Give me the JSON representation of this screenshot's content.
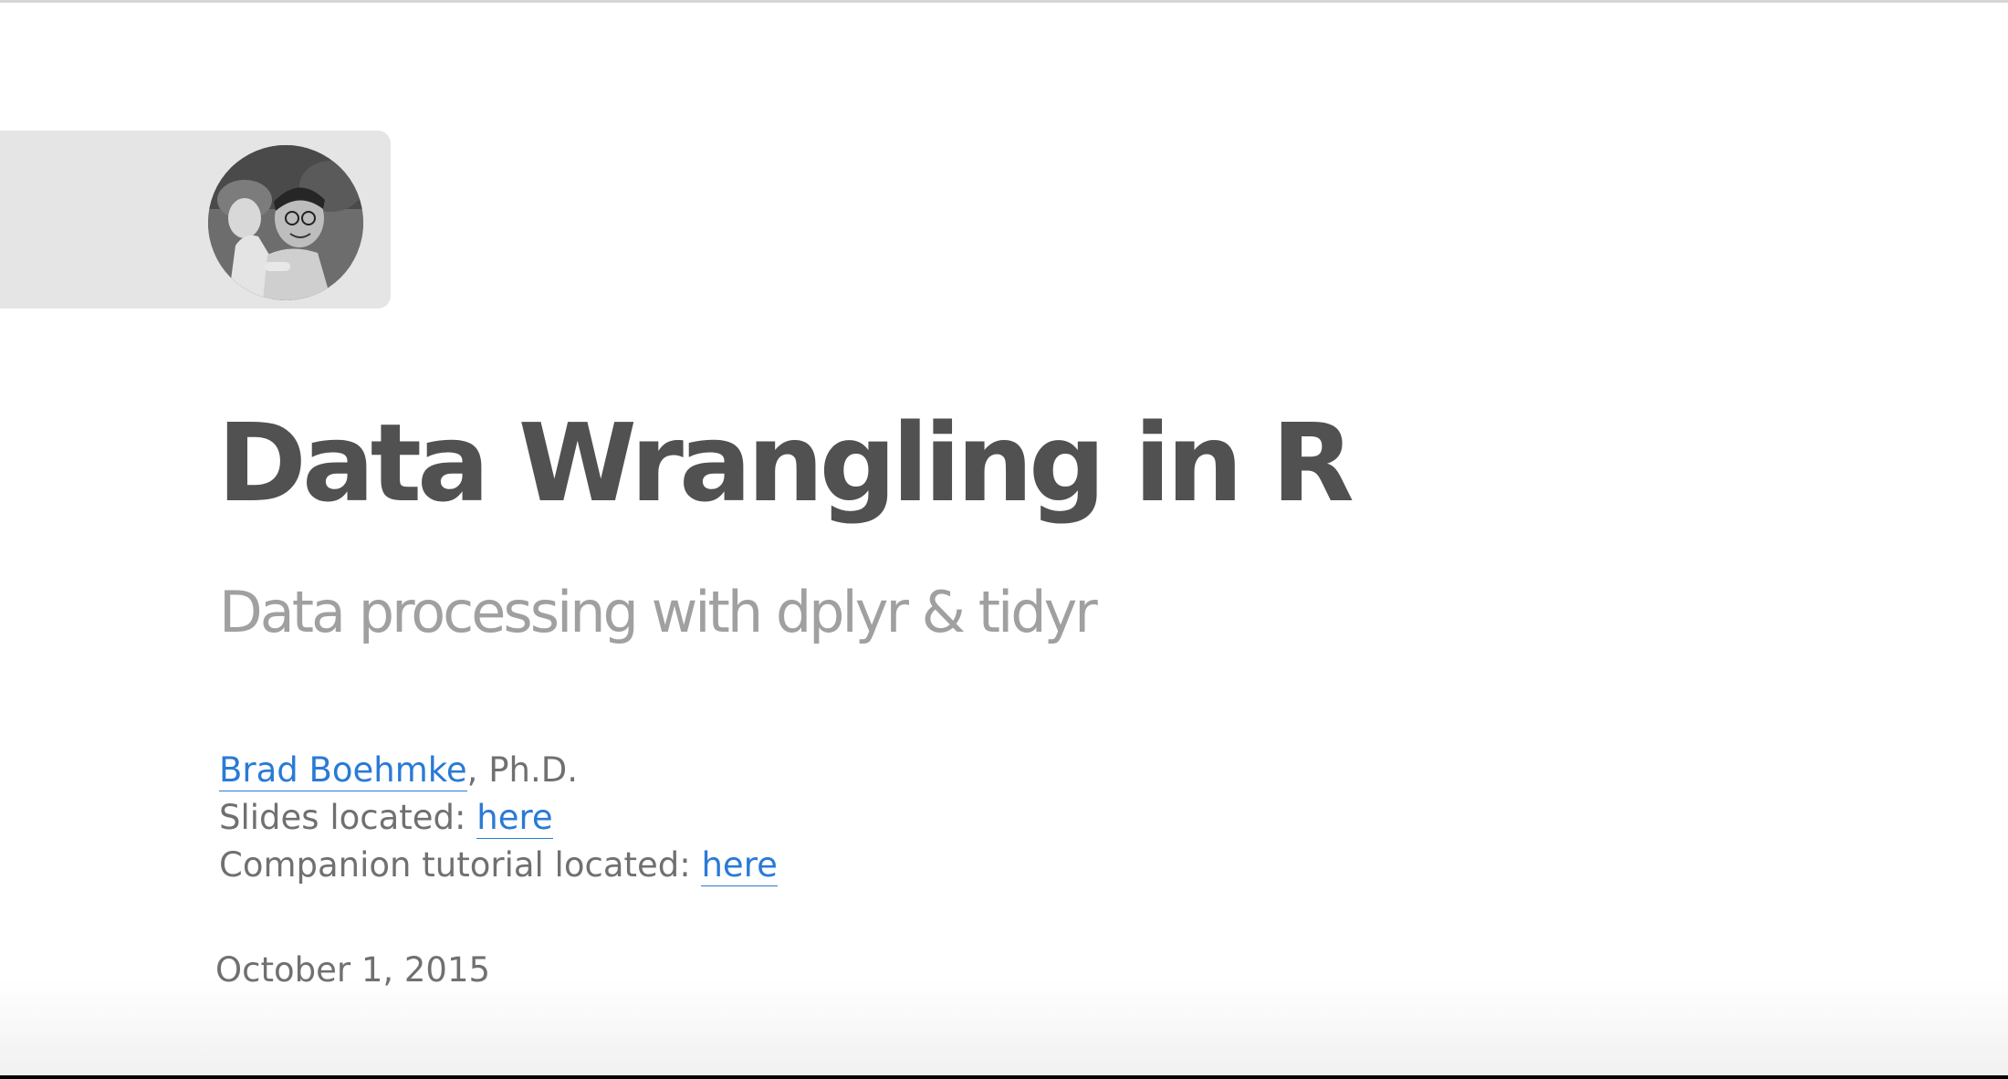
{
  "slide": {
    "title": "Data Wrangling in R",
    "subtitle": "Data processing with dplyr & tidyr",
    "author": {
      "name": "Brad Boehmke",
      "suffix": ", Ph.D."
    },
    "slides_line": {
      "label": "Slides located: ",
      "link_text": "here"
    },
    "tutorial_line": {
      "label": "Companion tutorial located: ",
      "link_text": "here"
    },
    "date": "October 1, 2015"
  },
  "logo": {
    "icon": "author-photo-avatar"
  },
  "colors": {
    "title": "#515151",
    "subtitle": "#a0a0a0",
    "body_text": "#707070",
    "link": "#2a7ad6",
    "logo_box": "#e5e5e5"
  }
}
